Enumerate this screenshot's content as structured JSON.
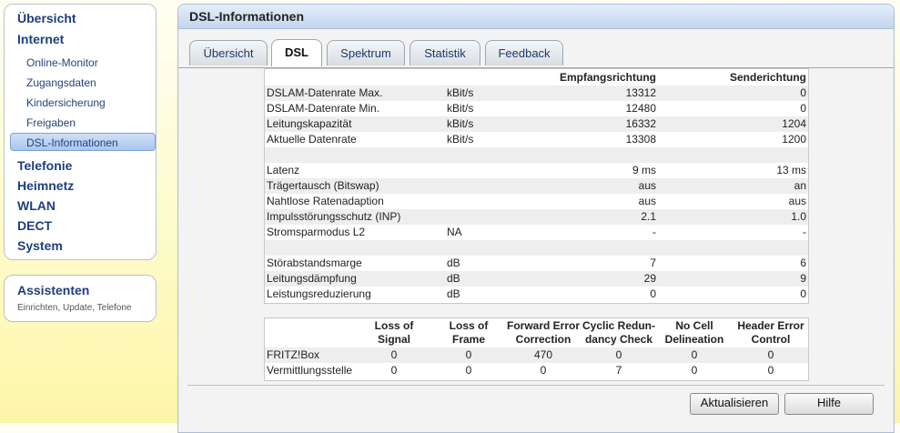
{
  "sidebar": {
    "top_items": [
      "Übersicht",
      "Internet",
      "Telefonie",
      "Heimnetz",
      "WLAN",
      "DECT",
      "System"
    ],
    "internet_sub": [
      "Online-Monitor",
      "Zugangsdaten",
      "Kindersicherung",
      "Freigaben",
      "DSL-Informationen"
    ],
    "assist_title": "Assistenten",
    "assist_sub": "Einrichten, Update, Telefone"
  },
  "header": {
    "title": "DSL-Informationen"
  },
  "tabs": [
    "Übersicht",
    "DSL",
    "Spektrum",
    "Statistik",
    "Feedback"
  ],
  "active_tab": "DSL",
  "dsl_table": {
    "col_headers": [
      "",
      "",
      "Empfangsrichtung",
      "Senderichtung"
    ],
    "rows": [
      [
        "DSLAM-Datenrate Max.",
        "kBit/s",
        "13312",
        "0"
      ],
      [
        "DSLAM-Datenrate Min.",
        "kBit/s",
        "12480",
        "0"
      ],
      [
        "Leitungskapazität",
        "kBit/s",
        "16332",
        "1204"
      ],
      [
        "Aktuelle Datenrate",
        "kBit/s",
        "13308",
        "1200"
      ],
      [
        "",
        "",
        "",
        ""
      ],
      [
        "Latenz",
        "",
        "9 ms",
        "13 ms"
      ],
      [
        "Trägertausch (Bitswap)",
        "",
        "aus",
        "an"
      ],
      [
        "Nahtlose Ratenadaption",
        "",
        "aus",
        "aus"
      ],
      [
        "Impulsstörungsschutz (INP)",
        "",
        "2.1",
        "1.0"
      ],
      [
        "Stromsparmodus L2",
        "NA",
        "-",
        "-"
      ],
      [
        "",
        "",
        "",
        ""
      ],
      [
        "Störabstandsmarge",
        "dB",
        "7",
        "6"
      ],
      [
        "Leitungsdämpfung",
        "dB",
        "29",
        "9"
      ],
      [
        "Leistungsreduzierung",
        "dB",
        "0",
        "0"
      ]
    ]
  },
  "error_table": {
    "col_headers": [
      [
        "Loss of",
        "Signal"
      ],
      [
        "Loss of",
        "Frame"
      ],
      [
        "Forward Error",
        "Correction"
      ],
      [
        "Cyclic Redun-",
        "dancy Check"
      ],
      [
        "No Cell",
        "Delineation"
      ],
      [
        "Header Error",
        "Control"
      ]
    ],
    "rows": [
      {
        "label": "FRITZ!Box",
        "values": [
          "0",
          "0",
          "470",
          "0",
          "0",
          "0"
        ]
      },
      {
        "label": "Vermittlungsstelle",
        "values": [
          "0",
          "0",
          "0",
          "7",
          "0",
          "0"
        ]
      }
    ]
  },
  "buttons": {
    "refresh": "Aktualisieren",
    "help": "Hilfe"
  }
}
